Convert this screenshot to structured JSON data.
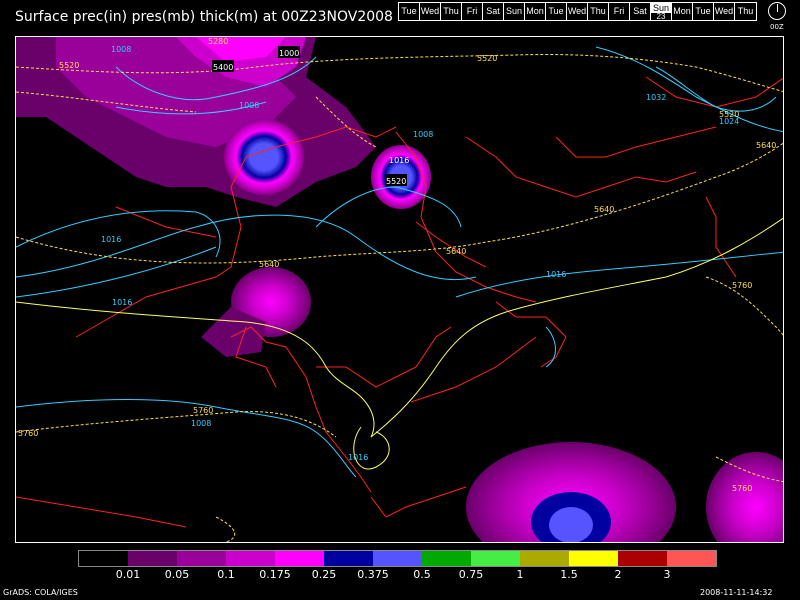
{
  "title": "Surface prec(in) pres(mb) thick(m) at 00Z23NOV2008",
  "days": [
    {
      "label": "Tue"
    },
    {
      "label": "Wed"
    },
    {
      "label": "Thu"
    },
    {
      "label": "Fri"
    },
    {
      "label": "Sat"
    },
    {
      "label": "Sun"
    },
    {
      "label": "Mon"
    },
    {
      "label": "Tue"
    },
    {
      "label": "Wed"
    },
    {
      "label": "Thu"
    },
    {
      "label": "Fri"
    },
    {
      "label": "Sat"
    },
    {
      "label": "Sun",
      "num": "23",
      "active": true
    },
    {
      "label": "Mon"
    },
    {
      "label": "Tue"
    },
    {
      "label": "Wed"
    },
    {
      "label": "Thu"
    }
  ],
  "clock_label": "00Z",
  "legend": {
    "colors": [
      "#000000",
      "#6a006a",
      "#9a009a",
      "#cc00cc",
      "#ff00ff",
      "#0000a0",
      "#5555ff",
      "#00aa00",
      "#44ee44",
      "#aaaa00",
      "#ffff00",
      "#aa0000",
      "#ff5555"
    ],
    "ticks": [
      "0.01",
      "0.05",
      "0.1",
      "0.175",
      "0.25",
      "0.375",
      "0.5",
      "0.75",
      "1",
      "1.5",
      "2",
      "3"
    ]
  },
  "map": {
    "pressure_labels": [
      {
        "text": "1008"
      },
      {
        "text": "1000"
      },
      {
        "text": "1008"
      },
      {
        "text": "1008"
      },
      {
        "text": "1016"
      },
      {
        "text": "1016"
      },
      {
        "text": "1016"
      },
      {
        "text": "1008"
      },
      {
        "text": "1016"
      },
      {
        "text": "1016"
      },
      {
        "text": "1032"
      },
      {
        "text": "1024"
      }
    ],
    "thickness_labels": [
      {
        "text": "5280"
      },
      {
        "text": "5400"
      },
      {
        "text": "5520"
      },
      {
        "text": "5520"
      },
      {
        "text": "5520"
      },
      {
        "text": "5520"
      },
      {
        "text": "5640"
      },
      {
        "text": "5640"
      },
      {
        "text": "5640"
      },
      {
        "text": "5640"
      },
      {
        "text": "5760"
      },
      {
        "text": "5760"
      },
      {
        "text": "5760"
      },
      {
        "text": "5760"
      }
    ]
  },
  "footer_left": "GrADS: COLA/IGES",
  "footer_right": "2008-11-11-14:32"
}
